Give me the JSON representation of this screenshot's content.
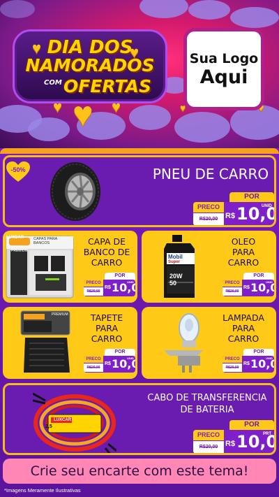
{
  "header": {
    "title_line1": "DIA DOS",
    "title_line2": "NAMORADOS",
    "title_com": "COM",
    "title_line3": "OFERTAS",
    "logo_line1": "Sua Logo",
    "logo_line2": "Aqui"
  },
  "featured": {
    "badge": "-50%",
    "name": "PNEU DE CARRO",
    "por": "POR",
    "preco": "PRECO",
    "old_price": "R$20,00",
    "currency": "R$",
    "value": "10,00",
    "unit": "UNID"
  },
  "products": [
    {
      "name_lines": [
        "CAPA DE",
        "BANCO DE",
        "CARRO"
      ],
      "por": "POR",
      "preco": "PRECO",
      "old_price": "R$20,00",
      "currency": "R$",
      "value": "10,00",
      "unit": "UNID"
    },
    {
      "name_lines": [
        "OLEO",
        "PARA",
        "CARRO"
      ],
      "por": "POR",
      "preco": "PRECO",
      "old_price": "R$20,00",
      "currency": "R$",
      "value": "10,00",
      "unit": "UNID"
    },
    {
      "name_lines": [
        "TAPETE",
        "PARA",
        "CARRO"
      ],
      "por": "POR",
      "preco": "PRECO",
      "old_price": "R$20,00",
      "currency": "R$",
      "value": "10,00",
      "unit": "UNID"
    },
    {
      "name_lines": [
        "LAMPADA",
        "PARA",
        "CARRO"
      ],
      "por": "POR",
      "preco": "PRECO",
      "old_price": "R$20,00",
      "currency": "R$",
      "value": "10,00",
      "unit": "UNID"
    }
  ],
  "bottom_product": {
    "name_lines": [
      "CABO DE TRANSFERENCIA",
      "DE BATERIA"
    ],
    "por": "POR",
    "preco": "PRECO",
    "old_price": "R$20,00",
    "currency": "R$",
    "value": "10,00",
    "unit": "PRT"
  },
  "package_texts": {
    "seat_brand": "LUXCAR",
    "seat_label": "CAPAS PARA BANCOS",
    "seat_premium": "PREMIUM",
    "oil_brand_1": "Mobil",
    "oil_brand_2": "Super",
    "oil_grade": "20W",
    "oil_grade2": "50",
    "mat_label": "PREMIUM",
    "cable_brand": "LUXCAR",
    "cable_size": "2,5"
  },
  "cta": "Crie seu encarte com este tema!",
  "footnote": "*Imagens Meramente Ilustrativas",
  "colors": {
    "purple": "#7f1fc9",
    "yellow": "#ffc917",
    "pink": "#ff86b5",
    "gold": "#ffd400"
  }
}
